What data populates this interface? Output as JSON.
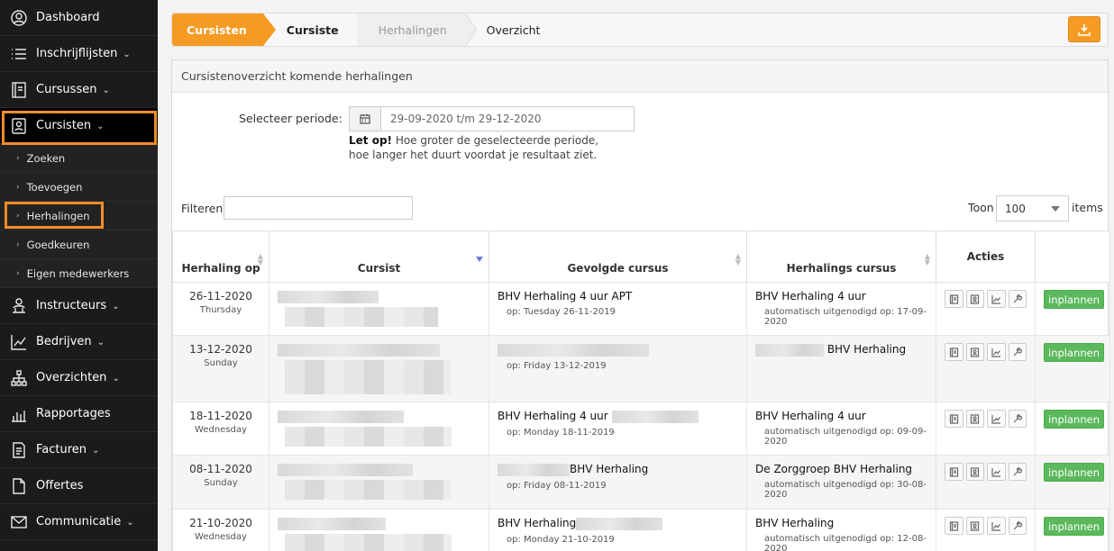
{
  "sidebar": {
    "items": [
      {
        "label": "Dashboard",
        "icon": "dashboard-icon"
      },
      {
        "label": "Inschrijflijsten",
        "icon": "list-icon"
      },
      {
        "label": "Cursussen",
        "icon": "book-icon"
      },
      {
        "label": "Cursisten",
        "icon": "student-icon"
      },
      {
        "label": "Instructeurs",
        "icon": "instructor-icon"
      },
      {
        "label": "Bedrijven",
        "icon": "company-icon"
      },
      {
        "label": "Overzichten",
        "icon": "hierarchy-icon"
      },
      {
        "label": "Rapportages",
        "icon": "bar-chart-icon"
      },
      {
        "label": "Facturen",
        "icon": "invoice-icon"
      },
      {
        "label": "Offertes",
        "icon": "document-icon"
      },
      {
        "label": "Communicatie",
        "icon": "mail-icon"
      }
    ],
    "subitems": [
      "Zoeken",
      "Toevoegen",
      "Herhalingen",
      "Goedkeuren",
      "Eigen medewerkers"
    ]
  },
  "breadcrumb": [
    "Cursisten",
    "Cursiste",
    "Herhalingen",
    "Overzicht"
  ],
  "panel": {
    "title": "Cursistenoverzicht komende herhalingen",
    "period_label": "Selecteer periode:",
    "period_value": "29-09-2020 t/m 29-12-2020",
    "note_bold": "Let op!",
    "note_line1": " Hoe groter de geselecteerde periode,",
    "note_line2": "hoe langer het duurt voordat je resultaat ziet.",
    "filter_label": "Filteren",
    "toon_label": "Toon",
    "toon_value": "100",
    "items_label": "items"
  },
  "table": {
    "headers": [
      "Herhaling op",
      "Cursist",
      "Gevolgde cursus",
      "Herhalings cursus",
      "Acties",
      ""
    ],
    "plan_label": "inplannen",
    "rows": [
      {
        "date": "26-11-2020",
        "day": "Thursday",
        "cursist": "",
        "course": "BHV Herhaling 4 uur APT",
        "course_sub": "op: Tuesday 26-11-2019",
        "repeat": "BHV Herhaling 4 uur",
        "repeat_sub": "automatisch uitgenodigd op: 17-09-2020"
      },
      {
        "date": "13-12-2020",
        "day": "Sunday",
        "cursist": "",
        "course": "",
        "course_sub": "op: Friday 13-12-2019",
        "repeat": "BHV Herhaling",
        "repeat_sub": ""
      },
      {
        "date": "18-11-2020",
        "day": "Wednesday",
        "cursist": "",
        "course": "BHV Herhaling 4 uur",
        "course_sub": "op: Monday 18-11-2019",
        "repeat": "BHV Herhaling 4 uur",
        "repeat_sub": "automatisch uitgenodigd op: 09-09-2020"
      },
      {
        "date": "08-11-2020",
        "day": "Sunday",
        "cursist": "",
        "course": "BHV Herhaling",
        "course_sub": "op: Friday 08-11-2019",
        "repeat": "De Zorggroep BHV Herhaling",
        "repeat_sub": "automatisch uitgenodigd op: 30-08-2020"
      },
      {
        "date": "21-10-2020",
        "day": "Wednesday",
        "cursist": "",
        "course": "BHV Herhaling",
        "course_sub": "op: Monday 21-10-2019",
        "repeat": "BHV Herhaling",
        "repeat_sub": "automatisch uitgenodigd op: 12-08-2020"
      }
    ]
  },
  "colors": {
    "accent": "#f59b23",
    "highlight": "#f28c28",
    "sidebar": "#1b1b1b",
    "success": "#5cb85c"
  }
}
